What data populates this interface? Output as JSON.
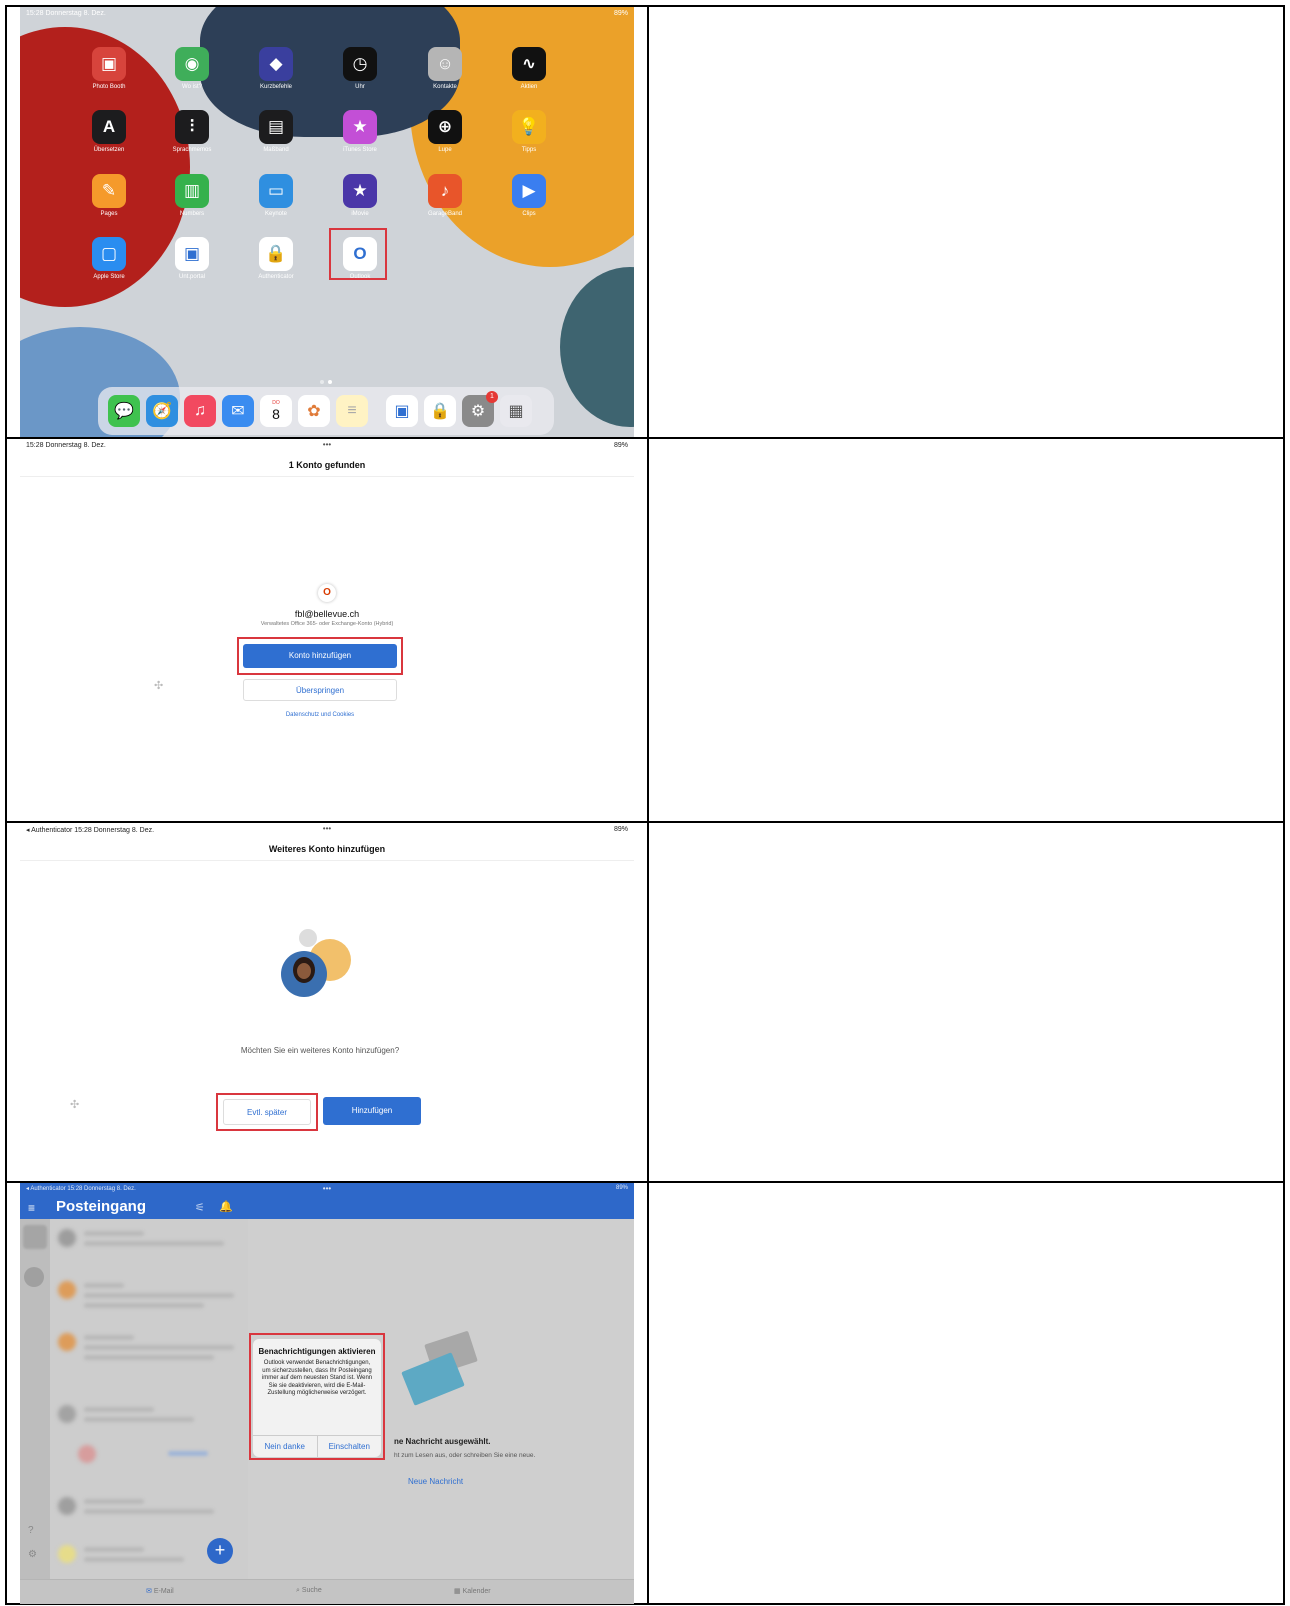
{
  "screen1": {
    "status_left": "15:28  Donnerstag 8. Dez.",
    "status_right": "89%",
    "apps": [
      {
        "label": "Photo Booth",
        "icon": "photo-booth-icon",
        "color": "#d7443c"
      },
      {
        "label": "Wo ist?",
        "icon": "find-my-icon",
        "color": "#3fae5a"
      },
      {
        "label": "Kurzbefehle",
        "icon": "shortcuts-icon",
        "color": "#3a3f9e"
      },
      {
        "label": "Uhr",
        "icon": "clock-icon",
        "color": "#111111"
      },
      {
        "label": "Kontakte",
        "icon": "contacts-icon",
        "color": "#b5b5b5"
      },
      {
        "label": "Aktien",
        "icon": "stocks-icon",
        "color": "#111111"
      },
      {
        "label": "Übersetzen",
        "icon": "translate-icon",
        "color": "#1c1c1e"
      },
      {
        "label": "Sprachmemos",
        "icon": "voice-memos-icon",
        "color": "#1c1c1e"
      },
      {
        "label": "Maßband",
        "icon": "measure-icon",
        "color": "#1c1c1e"
      },
      {
        "label": "iTunes Store",
        "icon": "itunes-store-icon",
        "color": "#c34fd6"
      },
      {
        "label": "Lupe",
        "icon": "magnifier-icon",
        "color": "#111111"
      },
      {
        "label": "Tipps",
        "icon": "tips-icon",
        "color": "#f2b01e"
      },
      {
        "label": "Pages",
        "icon": "pages-icon",
        "color": "#f59a2b"
      },
      {
        "label": "Numbers",
        "icon": "numbers-icon",
        "color": "#35b14c"
      },
      {
        "label": "Keynote",
        "icon": "keynote-icon",
        "color": "#2f8fe0"
      },
      {
        "label": "iMovie",
        "icon": "imovie-icon",
        "color": "#4a36a8"
      },
      {
        "label": "GarageBand",
        "icon": "garageband-icon",
        "color": "#e8552a"
      },
      {
        "label": "Clips",
        "icon": "clips-icon",
        "color": "#3a7ef0"
      },
      {
        "label": "Apple Store",
        "icon": "apple-store-icon",
        "color": "#2a8df0"
      },
      {
        "label": "Unt.portal",
        "icon": "company-portal-icon",
        "color": "#ffffff"
      },
      {
        "label": "Authenticator",
        "icon": "authenticator-icon",
        "color": "#ffffff"
      },
      {
        "label": "Outlook",
        "icon": "outlook-icon",
        "color": "#ffffff"
      }
    ],
    "dock_calendar_day": "8",
    "dock_calendar_weekday": "DO",
    "settings_badge": "1"
  },
  "screen2": {
    "status_left": "15:28  Donnerstag 8. Dez.",
    "status_right": "89%",
    "title": "1 Konto gefunden",
    "email": "fbl@bellevue.ch",
    "account_type": "Verwaltetes Office 365- oder Exchange-Konto (Hybrid)",
    "add_button": "Konto hinzufügen",
    "skip_button": "Überspringen",
    "privacy_link": "Datenschutz und Cookies"
  },
  "screen3": {
    "status_left": "◂ Authenticator  15:28  Donnerstag 8. Dez.",
    "status_right": "89%",
    "title": "Weiteres Konto hinzufügen",
    "question": "Möchten Sie ein weiteres Konto hinzufügen?",
    "later_button": "Evtl. später",
    "add_button": "Hinzufügen"
  },
  "screen4": {
    "status_left": "◂ Authenticator  15:28  Donnerstag 8. Dez.",
    "status_right": "89%",
    "inbox_title": "Posteingang",
    "alert_title": "Benachrichtigungen aktivieren",
    "alert_body": "Outlook verwendet Benachrichtigungen, um sicherzustellen, dass Ihr Posteingang immer auf dem neuesten Stand ist. Wenn Sie sie deaktivieren, wird die E-Mail-Zustellung möglicherweise verzögert.",
    "alert_cancel": "Nein danke",
    "alert_ok": "Einschalten",
    "empty_title": "ne Nachricht ausgewählt.",
    "empty_sub": "ht zum Lesen aus, oder schreiben Sie eine neue.",
    "new_message": "Neue Nachricht",
    "tabs": [
      "E-Mail",
      "Suche",
      "Kalender"
    ]
  }
}
